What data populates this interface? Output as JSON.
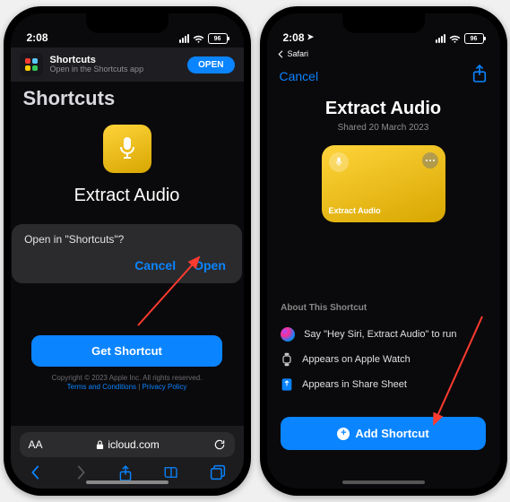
{
  "left": {
    "status": {
      "time": "2:08",
      "battery": "96"
    },
    "banner": {
      "title": "Shortcuts",
      "subtitle": "Open in the Shortcuts app",
      "action": "OPEN"
    },
    "page_title": "Shortcuts",
    "shortcut_name": "Extract Audio",
    "dialog": {
      "message": "Open in \"Shortcuts\"?",
      "cancel": "Cancel",
      "open": "Open"
    },
    "get_button": "Get Shortcut",
    "footer": {
      "copyright": "Copyright © 2023 Apple Inc. All rights reserved.",
      "terms": "Terms and Conditions",
      "privacy": "Privacy Policy"
    },
    "url": {
      "aa": "AA",
      "domain": "icloud.com"
    }
  },
  "right": {
    "status": {
      "time": "2:08",
      "battery": "96"
    },
    "back_safari": "Safari",
    "cancel": "Cancel",
    "title": "Extract Audio",
    "shared": "Shared 20 March 2023",
    "preview_label": "Extract Audio",
    "about": {
      "heading": "About This Shortcut",
      "siri": "Say \"Hey Siri, Extract Audio\" to run",
      "watch": "Appears on Apple Watch",
      "share": "Appears in Share Sheet"
    },
    "add_button": "Add Shortcut"
  }
}
